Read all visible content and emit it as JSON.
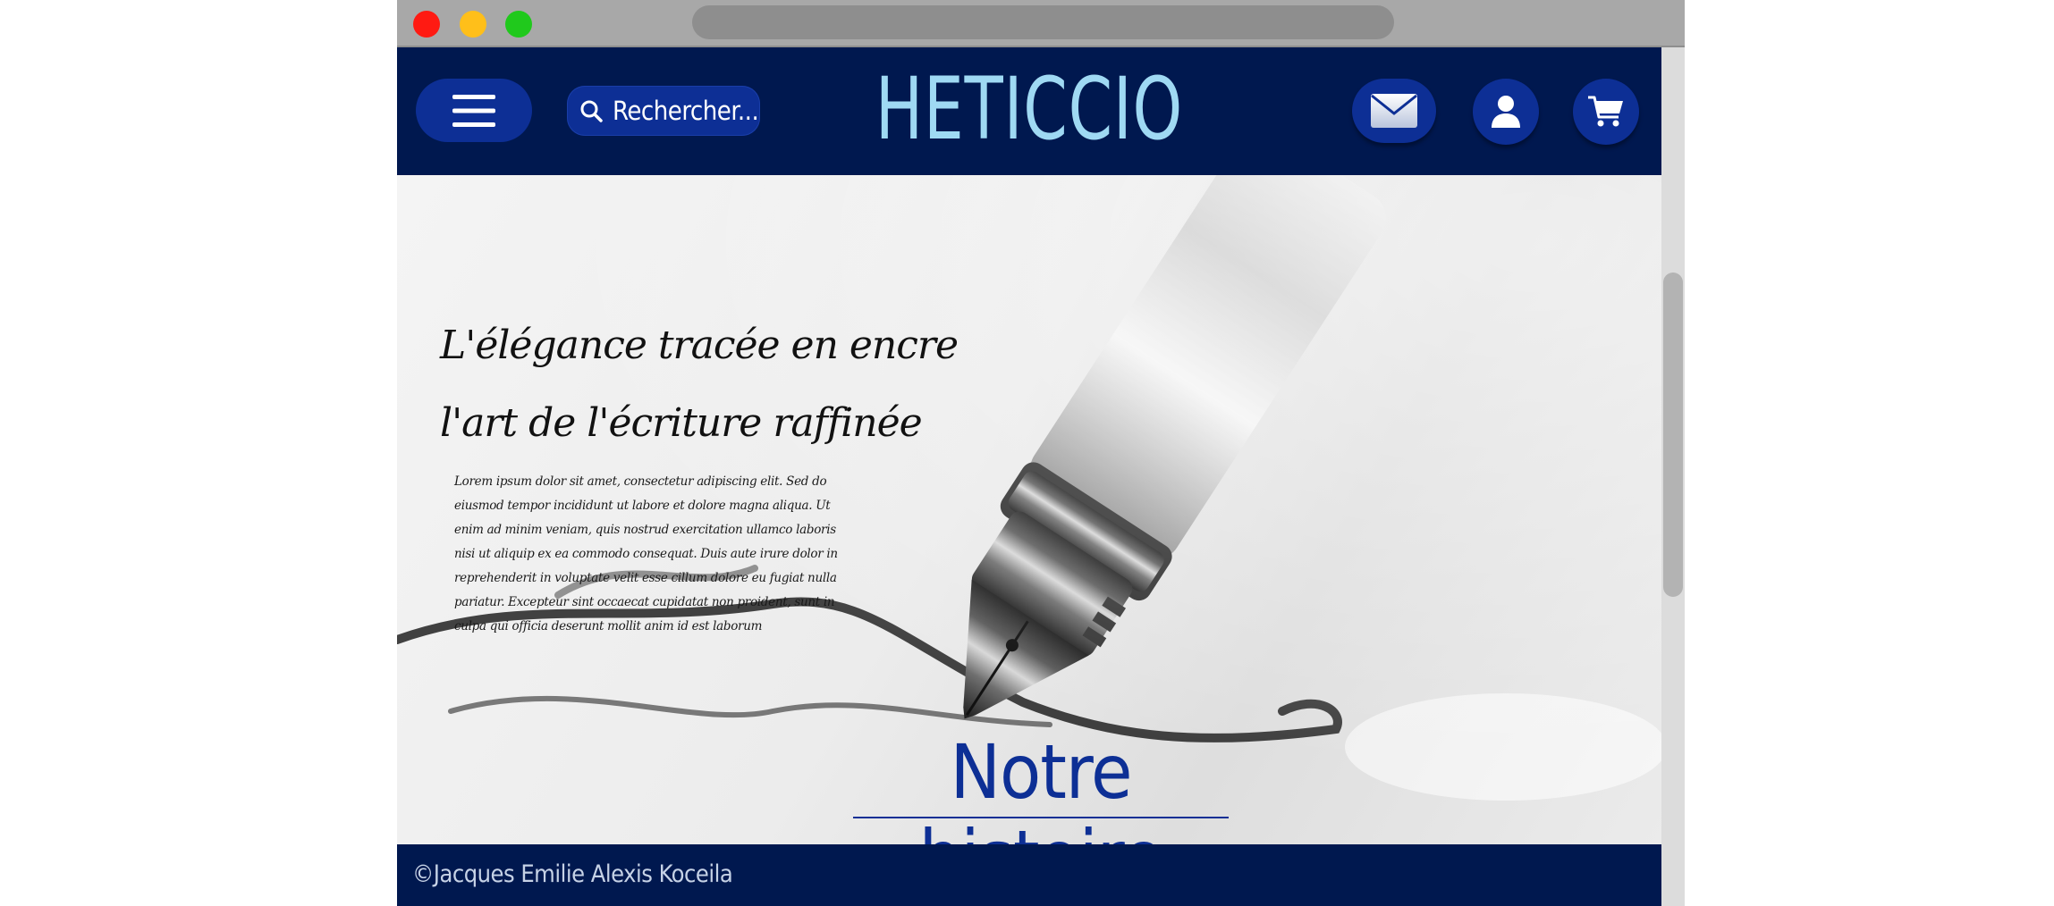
{
  "window": {
    "controls": [
      "close",
      "minimize",
      "maximize"
    ]
  },
  "header": {
    "menu_icon": "hamburger-icon",
    "search_placeholder": "Rechercher...",
    "search_icon": "search-icon",
    "brand": "HETICCIO",
    "actions": [
      {
        "name": "mail",
        "icon": "envelope-icon"
      },
      {
        "name": "account",
        "icon": "user-icon"
      },
      {
        "name": "cart",
        "icon": "shopping-cart-icon"
      }
    ]
  },
  "hero": {
    "headline_line1": "L'élégance tracée en encre",
    "headline_line2": "l'art de l'écriture raffinée",
    "body": "Lorem ipsum dolor sit amet, consectetur adipiscing elit. Sed do eiusmod tempor incididunt ut labore et dolore magna aliqua. Ut enim ad minim veniam, quis nostrud exercitation ullamco laboris nisi ut aliquip ex ea commodo consequat. Duis aute irure dolor in reprehenderit in voluptate velit esse cillum dolore eu fugiat nulla pariatur. Excepteur sint occaecat cupidatat non proident, sunt in culpa qui officia deserunt mollit anim id est laborum",
    "cta": "Notre histoire",
    "image": "fountain-pen-image"
  },
  "footer": {
    "copyright": "©Jacques Emilie Alexis Koceila"
  },
  "colors": {
    "header_bg": "#00184f",
    "button_bg": "#0d2f95",
    "brand_text": "#9fd9f3",
    "cta_text": "#0d2f95"
  }
}
